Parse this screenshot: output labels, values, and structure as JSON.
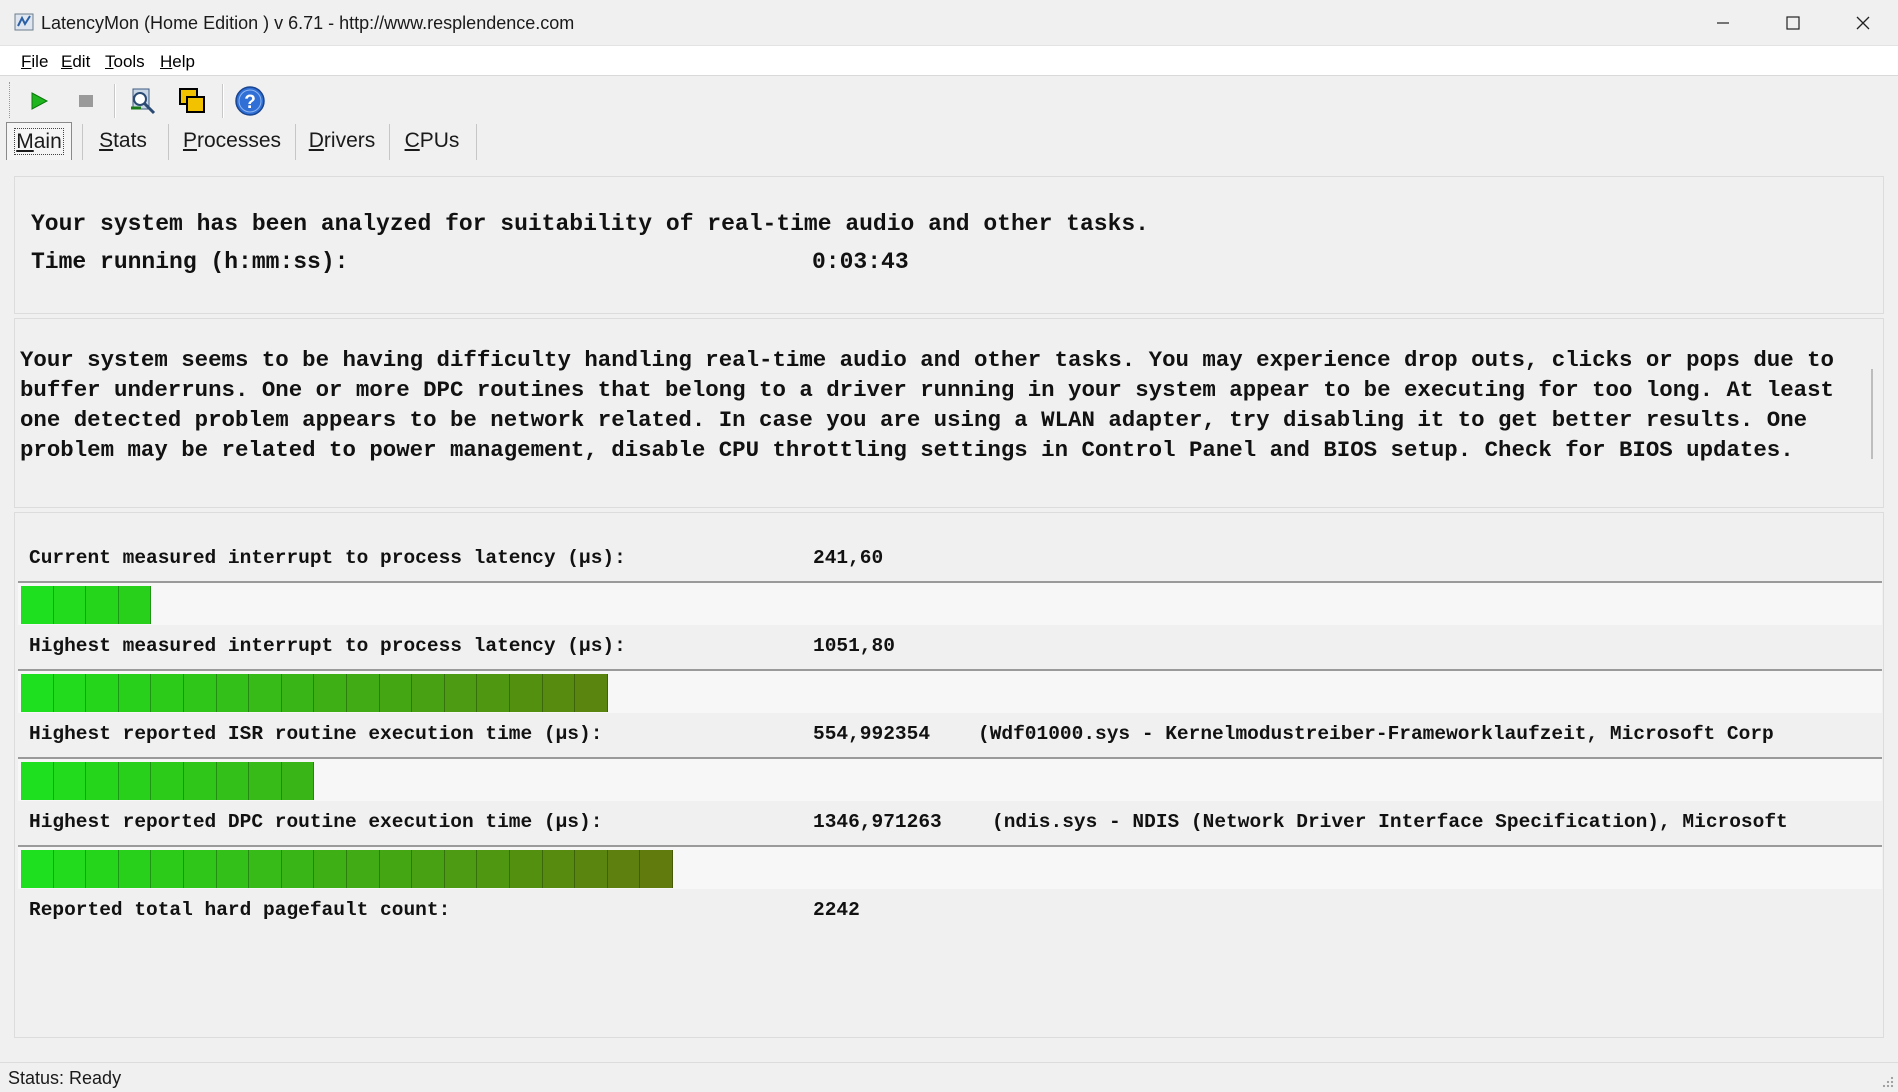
{
  "window": {
    "title": "LatencyMon  (Home Edition )  v 6.71 - http://www.resplendence.com"
  },
  "menu": {
    "file": "File",
    "edit": "Edit",
    "tools": "Tools",
    "help": "Help"
  },
  "toolbar": {
    "icons": [
      "play-icon",
      "stop-icon",
      "analyze-icon",
      "window-copy-icon",
      "help-icon"
    ]
  },
  "tabs": {
    "main": "Main",
    "stats": "Stats",
    "processes": "Processes",
    "drivers": "Drivers",
    "cpus": "CPUs",
    "active": "Main"
  },
  "header": {
    "summary": "Your system has been analyzed for suitability of real-time audio and other tasks.",
    "time_label": "Time running (h:mm:ss):",
    "time_value": "0:03:43"
  },
  "advice": {
    "text": "Your system seems to be having difficulty handling real-time audio and other tasks. You may experience drop outs, clicks or pops due to buffer underruns. One or more DPC routines that belong to a driver running in your system appear to be executing for too long. At least one detected problem appears to be network related. In case you are using a WLAN adapter, try disabling it to get better results. One problem may be related to power management, disable CPU throttling settings in Control Panel and BIOS setup. Check for BIOS updates."
  },
  "metrics": {
    "current_latency": {
      "label": "Current measured interrupt to process latency (µs):",
      "value": "241,60",
      "bar_segments": 4
    },
    "highest_latency": {
      "label": "Highest measured interrupt to process latency (µs):",
      "value": "1051,80",
      "bar_segments": 18
    },
    "isr": {
      "label": "Highest reported ISR routine execution time (µs):",
      "value": "554,992354",
      "desc": "(Wdf01000.sys - Kernelmodustreiber-Frameworklaufzeit, Microsoft Corp",
      "bar_segments": 9
    },
    "dpc": {
      "label": "Highest reported DPC routine execution time (µs):",
      "value": "1346,971263",
      "desc": "(ndis.sys - NDIS (Network Driver Interface Specification), Microsoft",
      "bar_segments": 20
    },
    "pagefaults": {
      "label": "Reported total hard pagefault count:",
      "value": "2242"
    }
  },
  "colors": {
    "bar_start": "#1ee01e",
    "bar_end": "#6b6b0a",
    "bar_track": "#f7f7f7"
  },
  "status": {
    "text": "Status: Ready"
  }
}
